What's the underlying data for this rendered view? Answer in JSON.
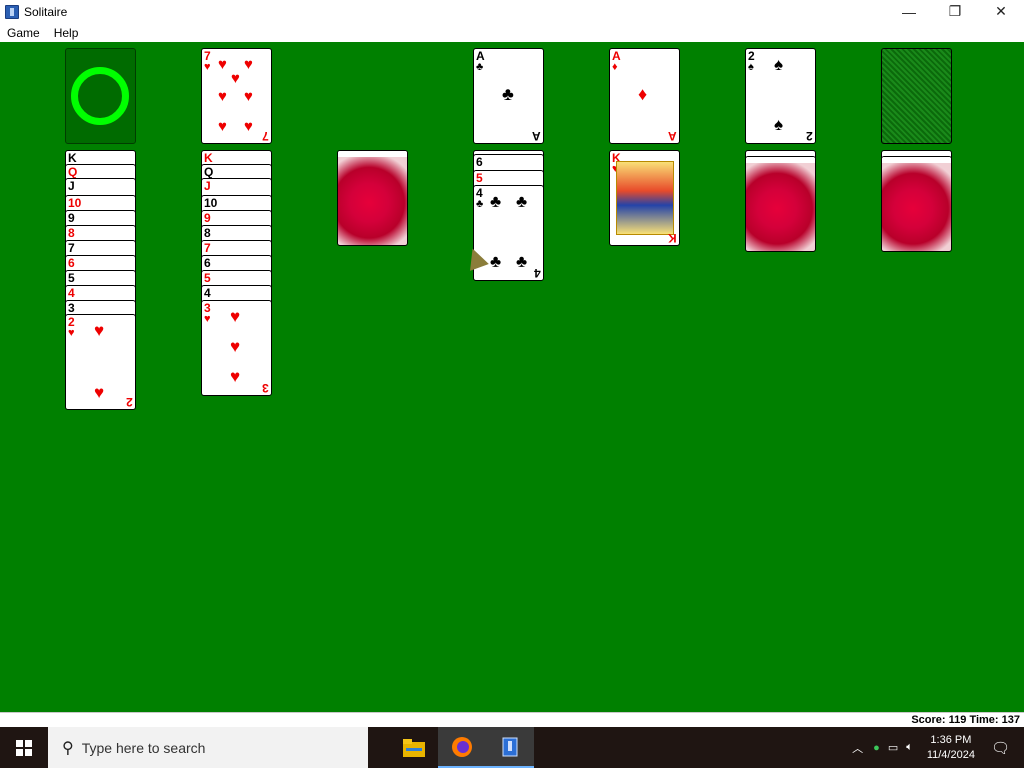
{
  "window": {
    "title": "Solitaire"
  },
  "menus": [
    "Game",
    "Help"
  ],
  "controls": {
    "minimize": "—",
    "maximize": "❐",
    "close": "✕"
  },
  "status": {
    "text": "Score: 119 Time: 137"
  },
  "taskbar": {
    "search_placeholder": "Type here to search",
    "time": "1:36 PM",
    "date": "11/4/2024"
  },
  "colors": {
    "felt": "#008000",
    "red": "#e00000",
    "black": "#000000"
  },
  "foundations": [
    {
      "rank": "A",
      "suit": "♣"
    },
    {
      "rank": "A",
      "suit": "♦"
    },
    {
      "rank": "2",
      "suit": "♠"
    }
  ],
  "tableau": {
    "col1": [
      "K",
      "Q",
      "J",
      "10",
      "9",
      "8",
      "7",
      "6",
      "5",
      "4",
      "3",
      "2"
    ],
    "col1_top": {
      "rank": "2",
      "suit": "♥"
    },
    "col2": [
      "K",
      "Q",
      "J",
      "10",
      "9",
      "8",
      "7",
      "6",
      "5",
      "4",
      "3"
    ],
    "col2_top": {
      "rank": "3",
      "suit": "♥"
    },
    "col4": [
      "6",
      "5",
      "4"
    ],
    "col4_top": {
      "rank": "4",
      "suit": "♣"
    },
    "col5_top": {
      "rank": "K",
      "suit": "♥"
    },
    "waste_top": {
      "rank": "7",
      "suit": "♥"
    }
  }
}
